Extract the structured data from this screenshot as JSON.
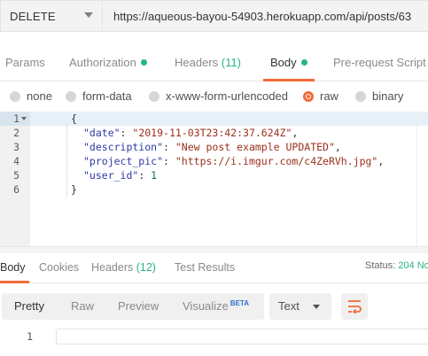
{
  "request": {
    "method": "DELETE",
    "url": "https://aqueous-bayou-54903.herokuapp.com/api/posts/63"
  },
  "request_tabs": {
    "params": "Params",
    "authorization": "Authorization",
    "headers": "Headers",
    "headers_count": "(11)",
    "body": "Body",
    "prerequest": "Pre-request Script"
  },
  "body_types": {
    "none": "none",
    "form_data": "form-data",
    "urlencoded": "x-www-form-urlencoded",
    "raw": "raw",
    "binary": "binary",
    "selected": "raw"
  },
  "editor": {
    "line_numbers": [
      "1",
      "2",
      "3",
      "4",
      "5",
      "6"
    ],
    "open_brace": "{",
    "close_brace": "}",
    "fields": [
      {
        "key": "\"date\"",
        "value": "\"2019-11-03T23:42:37.624Z\"",
        "comma": ","
      },
      {
        "key": "\"description\"",
        "value": "\"New post example UPDATED\"",
        "comma": ","
      },
      {
        "key": "\"project_pic\"",
        "value": "\"https://i.imgur.com/c4ZeRVh.jpg\"",
        "comma": ","
      },
      {
        "key": "\"user_id\"",
        "value": "1",
        "comma": ""
      }
    ]
  },
  "response_tabs": {
    "body": "Body",
    "cookies": "Cookies",
    "headers": "Headers",
    "headers_count": "(12)",
    "test_results": "Test Results"
  },
  "status": {
    "label": "Status:",
    "value": "204 No"
  },
  "response_toolbar": {
    "pretty": "Pretty",
    "raw": "Raw",
    "preview": "Preview",
    "visualize": "Visualize",
    "beta": "BETA",
    "language": "Text"
  },
  "response_body": {
    "line_number": "1"
  },
  "colors": {
    "accent": "#f26b3a",
    "success": "#26b47f",
    "json_key": "#2f3aa3",
    "json_string": "#9b2f1c",
    "json_number": "#0b7a3e"
  },
  "icons": [
    "caret-down-icon",
    "wrap-lines-icon"
  ]
}
